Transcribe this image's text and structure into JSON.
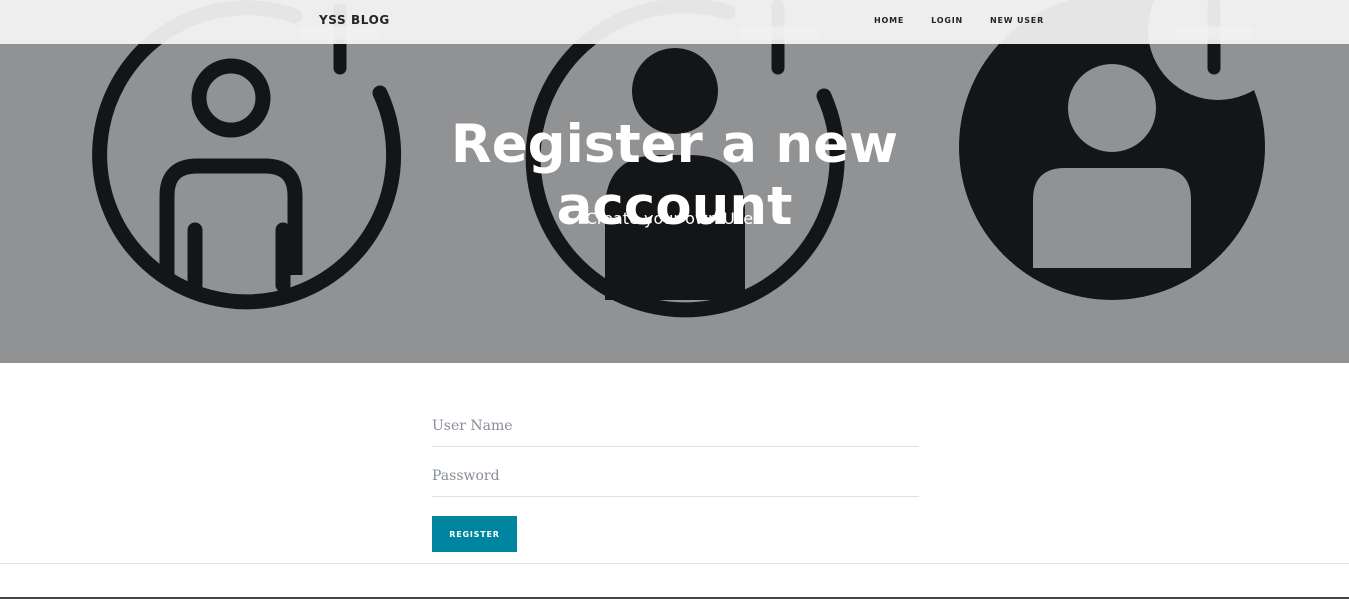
{
  "nav": {
    "brand": "YSS BLOG",
    "links": [
      "HOME",
      "LOGIN",
      "NEW USER"
    ]
  },
  "hero": {
    "title": "Register a new account",
    "subtitle": "Create your own User.",
    "background_icons": [
      "add-user-outline-icon",
      "add-user-filled-icon",
      "add-user-circle-icon"
    ]
  },
  "form": {
    "username_placeholder": "User Name",
    "username_value": "",
    "password_placeholder": "Password",
    "password_value": "",
    "submit_label": "REGISTER"
  },
  "colors": {
    "hero_overlay": "#919294",
    "icon_dark": "#141517",
    "button": "#0085a1",
    "navbar": "#f5f5f5"
  }
}
